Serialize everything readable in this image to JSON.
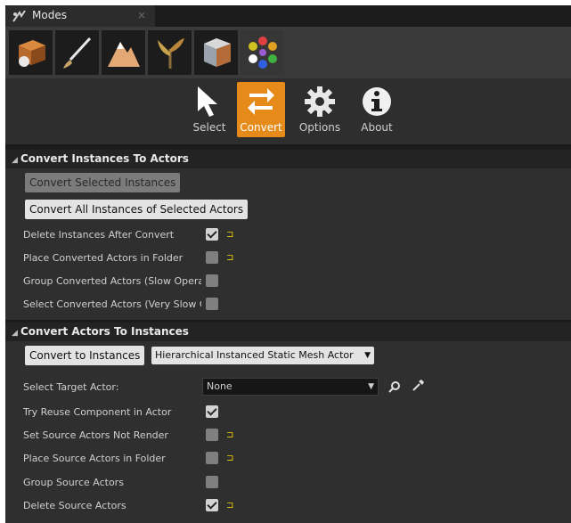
{
  "tab": {
    "title": "Modes",
    "close": "×"
  },
  "modes": [
    {
      "name": "place"
    },
    {
      "name": "paint"
    },
    {
      "name": "landscape"
    },
    {
      "name": "foliage"
    },
    {
      "name": "geometry"
    },
    {
      "name": "extra"
    }
  ],
  "tools": {
    "select": "Select",
    "convert": "Convert",
    "options": "Options",
    "about": "About"
  },
  "section1": {
    "title": "Convert Instances To Actors",
    "convert_selected": "Convert Selected Instances",
    "convert_all": "Convert All Instances of Selected Actors",
    "rows": [
      {
        "label": "Delete Instances After Convert",
        "checked": true,
        "reset": true
      },
      {
        "label": "Place Converted Actors in Folder",
        "checked": false,
        "reset": true
      },
      {
        "label": "Group Converted Actors (Slow Operati",
        "checked": false,
        "reset": false
      },
      {
        "label": "Select Converted Actors (Very Slow Op",
        "checked": false,
        "reset": false
      }
    ]
  },
  "section2": {
    "title": "Convert Actors To Instances",
    "convert_btn": "Convert to Instances",
    "actor_type": "Hierarchical Instanced Static Mesh Actor",
    "target_label": "Select Target Actor:",
    "target_value": "None",
    "rows": [
      {
        "label": "Try Reuse Component in Actor",
        "checked": true,
        "reset": false
      },
      {
        "label": "Set Source Actors Not Render",
        "checked": false,
        "reset": true
      },
      {
        "label": "Place Source Actors in Folder",
        "checked": false,
        "reset": true
      },
      {
        "label": "Group Source Actors",
        "checked": false,
        "reset": false
      },
      {
        "label": "Delete Source Actors",
        "checked": true,
        "reset": true
      }
    ]
  },
  "icons": {
    "reset": "reset-to-default-icon",
    "search": "search-icon",
    "picker": "eyedropper-icon"
  }
}
